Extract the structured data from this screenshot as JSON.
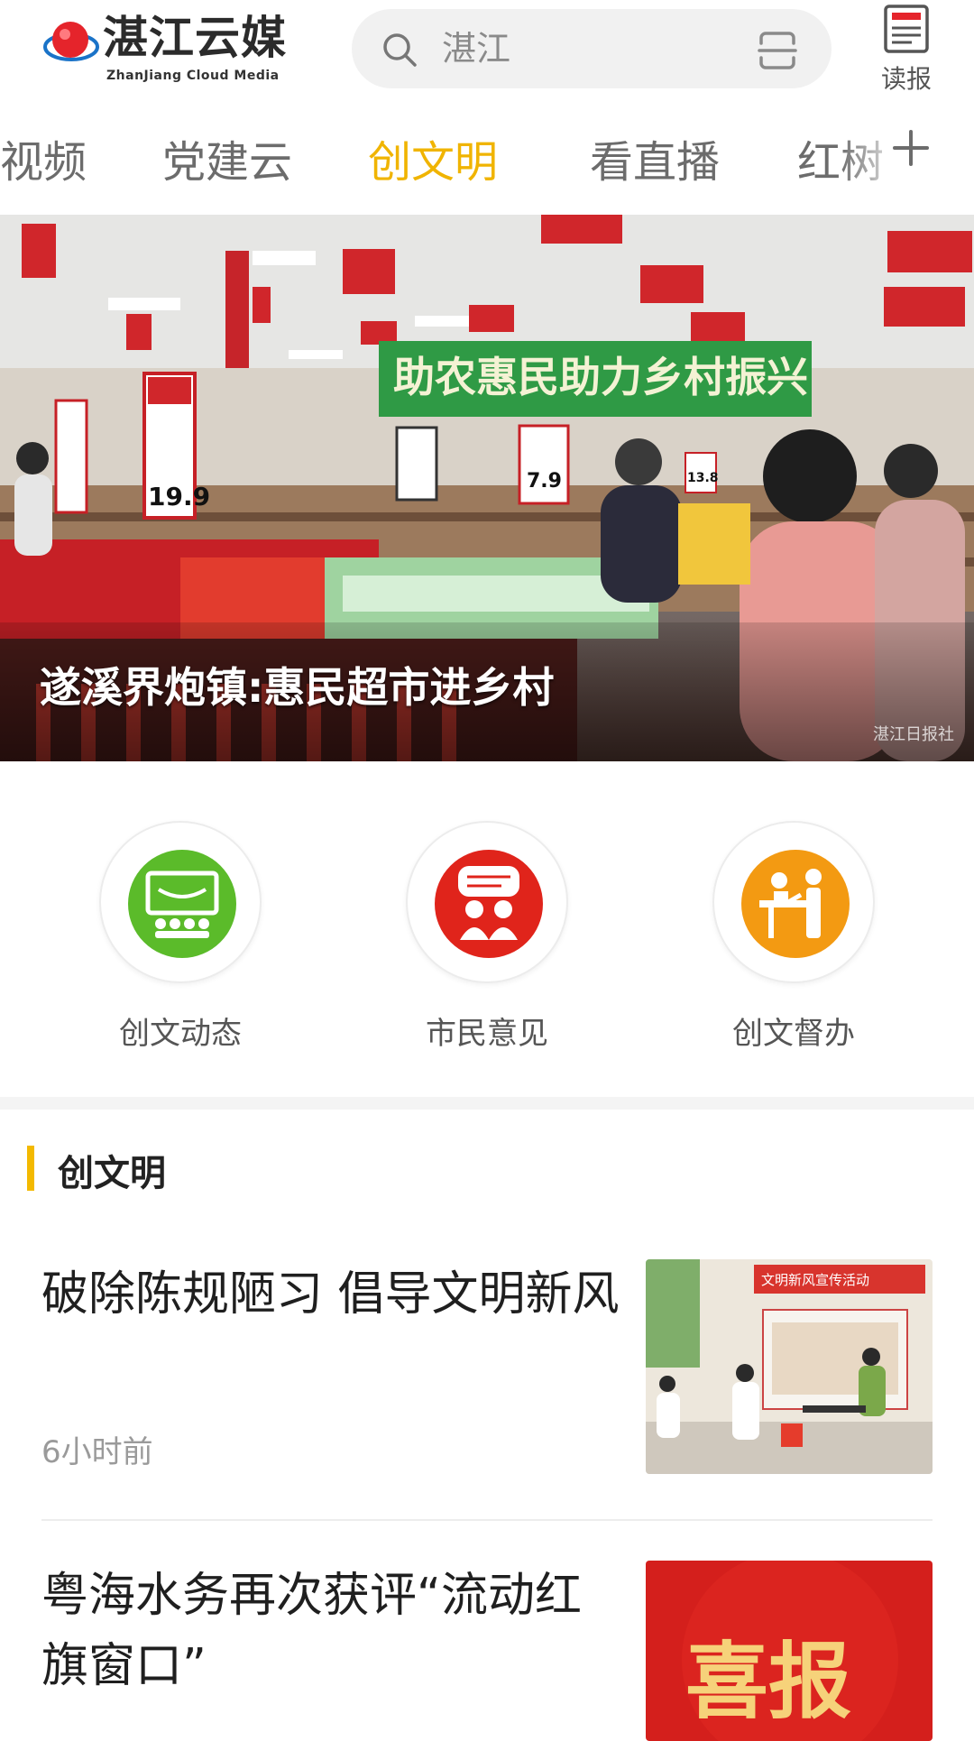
{
  "header": {
    "logo_name": "湛江云媒",
    "logo_sub": "ZhanJiang Cloud Media",
    "search_placeholder": "湛江",
    "epaper_label": "读报"
  },
  "tabs": [
    {
      "label": "视频"
    },
    {
      "label": "党建云"
    },
    {
      "label": "创文明",
      "active": true
    },
    {
      "label": "看直播"
    },
    {
      "label": "红树"
    }
  ],
  "banner": {
    "caption": "遂溪界炮镇:惠民超市进乡村",
    "watermark": "湛江日报社",
    "store_banner_text": "助农惠民助力乡村振兴",
    "price_tags": [
      "19.9",
      "7.9",
      "13.8"
    ]
  },
  "quick_entries": [
    {
      "label": "创文动态",
      "color": "#5bbb2a",
      "icon": "screen-audience-icon"
    },
    {
      "label": "市民意见",
      "color": "#e0241b",
      "icon": "speech-people-icon"
    },
    {
      "label": "创文督办",
      "color": "#f39a12",
      "icon": "desk-supervision-icon"
    }
  ],
  "section": {
    "title": "创文明"
  },
  "news": [
    {
      "title": "破除陈规陋习 倡导文明新风",
      "time": "6小时前",
      "thumb_text": "文明新风宣传活动"
    },
    {
      "title": "粤海水务再次获评“流动红旗窗口”",
      "thumb_text": "喜报"
    }
  ],
  "colors": {
    "accent": "#f0b400",
    "section_bar": "#f3b900",
    "tab_inactive": "#6c6c6c"
  }
}
